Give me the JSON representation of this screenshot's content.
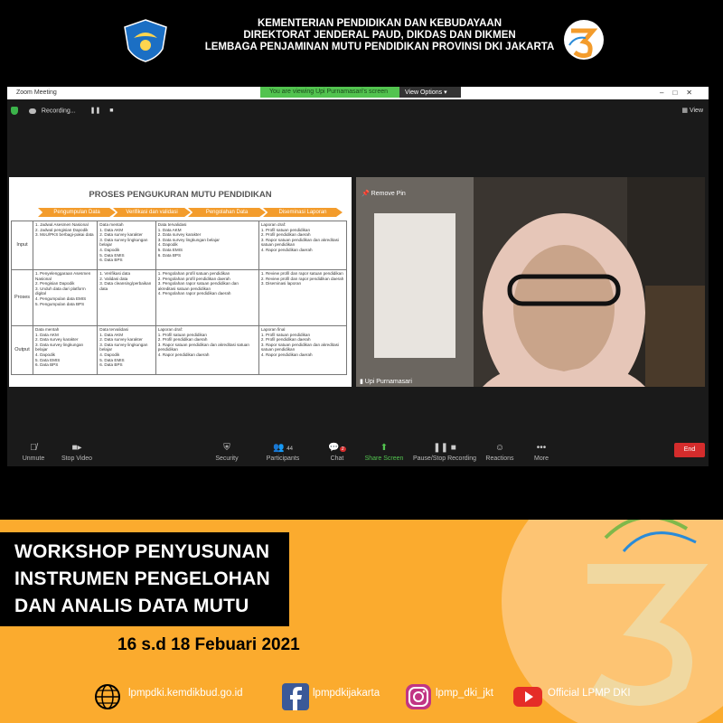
{
  "header": {
    "line1": "KEMENTERIAN PENDIDIKAN DAN KEBUDAYAAN",
    "line2": "DIREKTORAT JENDERAL PAUD, DIKDAS DAN DIKMEN",
    "line3": "LEMBAGA PENJAMINAN MUTU PENDIDIKAN PROVINSI DKI JAKARTA"
  },
  "zoom": {
    "window_title": "Zoom Meeting",
    "banner": "You are viewing Upi Purnamasari's screen",
    "view_options": "View Options",
    "recording": "Recording...",
    "view": "View",
    "remove_pin": "Remove Pin",
    "participant_name": "Upi Purnamasari",
    "participants_count": "44",
    "chat_badge": "2",
    "toolbar": {
      "unmute": "Unmute",
      "stop_video": "Stop Video",
      "security": "Security",
      "participants": "Participants",
      "chat": "Chat",
      "share": "Share Screen",
      "recording": "Pause/Stop Recording",
      "reactions": "Reactions",
      "more": "More",
      "end": "End"
    }
  },
  "slide": {
    "title": "PROSES PENGUKURAN MUTU PENDIDIKAN",
    "stages": [
      "Pengumpulan Data",
      "Verifikasi dan validasi",
      "Pengolahan Data",
      "Diseminasi Laporan"
    ],
    "rows": [
      {
        "label": "Input",
        "cells": [
          "1. Jadwal Asesmen Nasional\n2. Jadwal pengisian Dapodik\n3. MoU/PKS berbagi-pakai data",
          "Data mentah\n1. Data AKM\n2. Data survey karakter\n3. Data survey lingkungan belajar\n4. Dapodik\n5. Data EMIS\n6. Data BPS",
          "Data tervalidasi\n1. Data AKM\n2. Data survey karakter\n3. Data survey lingkungan belajar\n4. Dapodik\n5. Data EMIS\n6. Data BPS",
          "Laporan draf:\n1. Profil satuan pendidikan\n2. Profil pendidikan daerah\n3. Rapor satuan pendidikan dan akreditasi satuan pendidikan\n4. Rapor pendidikan daerah"
        ]
      },
      {
        "label": "Proses",
        "cells": [
          "1. Penyelenggaraan Asesmen Nasional\n2. Pengisian Dapodik\n3. Unduh data dari platform digital\n4. Pengumpulan data EMIS\n5. Pengumpulan data BPS",
          "1. Verifikasi data\n2. Validasi data\n3. Data cleansing/perbaikan data",
          "1. Pengolahan profil satuan pendidikan\n2. Pengolahan profil pendidikan daerah\n3. Pengolahan rapor satuan pendidikan dan akreditasi satuan pendidikan\n4. Pengolahan rapor pendidikan daerah",
          "1. Review profil dan rapor satuan pendidikan\n2. Review profil dan rapor pendidikan daerah\n3. Diseminasi laporan"
        ]
      },
      {
        "label": "Output",
        "cells": [
          "Data mentah\n1. Data AKM\n2. Data survey karakter\n3. Data survey lingkungan belajar\n4. Dapodik\n5. Data EMIS\n6. Data BPS",
          "Data tervalidasi\n1. Data AKM\n2. Data survey karakter\n3. Data survey lingkungan belajar\n4. Dapodik\n5. Data EMIS\n6. Data BPS",
          "Laporan draf:\n1. Profil satuan pendidikan\n2. Profil pendidikan daerah\n3. Rapor satuan pendidikan dan akreditasi satuan pendidikan\n4. Rapor pendidikan daerah",
          "Laporan final\n1. Profil satuan pendidikan\n2. Profil pendidikan daerah\n3. Rapor satuan pendidikan dan akreditasi satuan pendidikan\n4. Rapor pendidikan daerah"
        ]
      }
    ]
  },
  "workshop": {
    "line1": "WORKSHOP PENYUSUNAN",
    "line2": "INSTRUMEN PENGELOHAN",
    "line3": "DAN ANALIS DATA MUTU",
    "date": "16 s.d 18 Febuari 2021"
  },
  "footer": {
    "web": "lpmpdki.kemdikbud.go.id",
    "facebook": "lpmpdkijakarta",
    "instagram": "lpmp_dki_jkt",
    "youtube": "Official LPMP DKI"
  },
  "colors": {
    "accent": "#fbab2e",
    "chevron": "#f39c2c",
    "share_green": "#52c34f",
    "end_red": "#d42c2c"
  }
}
